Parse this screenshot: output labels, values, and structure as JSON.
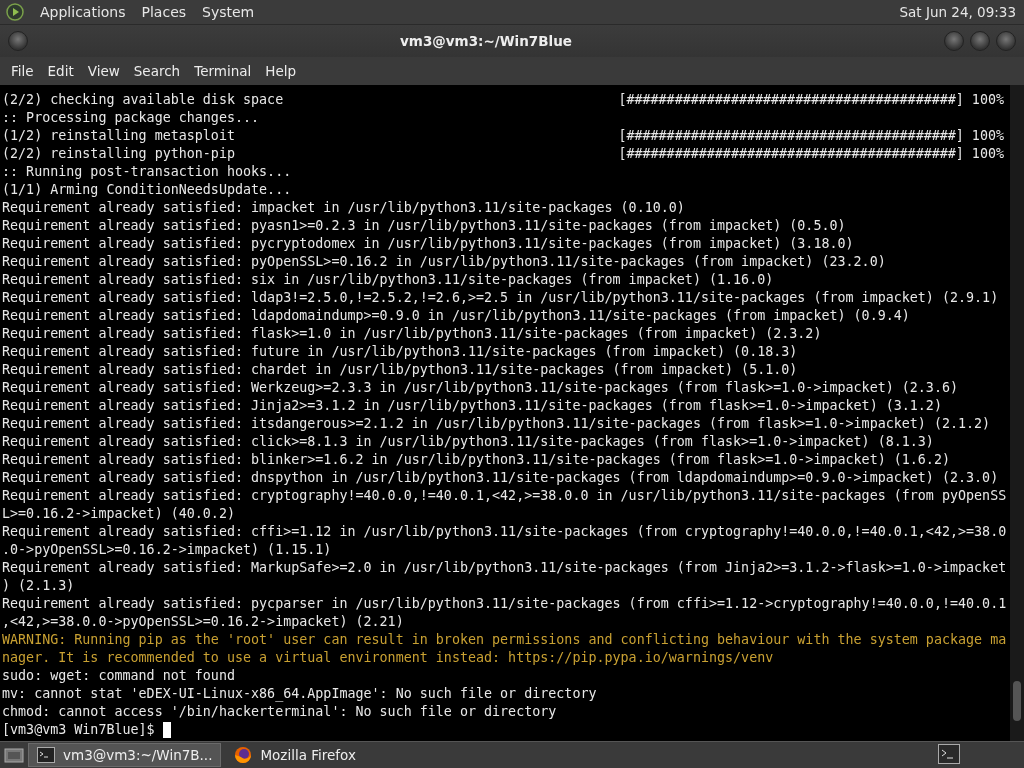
{
  "top_panel": {
    "menus": [
      "Applications",
      "Places",
      "System"
    ],
    "clock": "Sat Jun 24, 09:33"
  },
  "window": {
    "title": "vm3@vm3:~/Win7Blue"
  },
  "menu_bar": [
    "File",
    "Edit",
    "View",
    "Search",
    "Terminal",
    "Help"
  ],
  "terminal": {
    "lines": [
      {
        "kind": "progress",
        "text": "(2/2) checking available disk space",
        "bar": "[#########################################]",
        "percent": "100%"
      },
      {
        "kind": "text",
        "text": ":: Processing package changes..."
      },
      {
        "kind": "progress",
        "text": "(1/2) reinstalling metasploit",
        "bar": "[#########################################]",
        "percent": "100%"
      },
      {
        "kind": "progress",
        "text": "(2/2) reinstalling python-pip",
        "bar": "[#########################################]",
        "percent": "100%"
      },
      {
        "kind": "text",
        "text": ":: Running post-transaction hooks..."
      },
      {
        "kind": "text",
        "text": "(1/1) Arming ConditionNeedsUpdate..."
      },
      {
        "kind": "text",
        "text": "Requirement already satisfied: impacket in /usr/lib/python3.11/site-packages (0.10.0)"
      },
      {
        "kind": "text",
        "text": "Requirement already satisfied: pyasn1>=0.2.3 in /usr/lib/python3.11/site-packages (from impacket) (0.5.0)"
      },
      {
        "kind": "text",
        "text": "Requirement already satisfied: pycryptodomex in /usr/lib/python3.11/site-packages (from impacket) (3.18.0)"
      },
      {
        "kind": "text",
        "text": "Requirement already satisfied: pyOpenSSL>=0.16.2 in /usr/lib/python3.11/site-packages (from impacket) (23.2.0)"
      },
      {
        "kind": "text",
        "text": "Requirement already satisfied: six in /usr/lib/python3.11/site-packages (from impacket) (1.16.0)"
      },
      {
        "kind": "text",
        "text": "Requirement already satisfied: ldap3!=2.5.0,!=2.5.2,!=2.6,>=2.5 in /usr/lib/python3.11/site-packages (from impacket) (2.9.1)"
      },
      {
        "kind": "text",
        "text": "Requirement already satisfied: ldapdomaindump>=0.9.0 in /usr/lib/python3.11/site-packages (from impacket) (0.9.4)"
      },
      {
        "kind": "text",
        "text": "Requirement already satisfied: flask>=1.0 in /usr/lib/python3.11/site-packages (from impacket) (2.3.2)"
      },
      {
        "kind": "text",
        "text": "Requirement already satisfied: future in /usr/lib/python3.11/site-packages (from impacket) (0.18.3)"
      },
      {
        "kind": "text",
        "text": "Requirement already satisfied: chardet in /usr/lib/python3.11/site-packages (from impacket) (5.1.0)"
      },
      {
        "kind": "text",
        "text": "Requirement already satisfied: Werkzeug>=2.3.3 in /usr/lib/python3.11/site-packages (from flask>=1.0->impacket) (2.3.6)"
      },
      {
        "kind": "text",
        "text": "Requirement already satisfied: Jinja2>=3.1.2 in /usr/lib/python3.11/site-packages (from flask>=1.0->impacket) (3.1.2)"
      },
      {
        "kind": "text",
        "text": "Requirement already satisfied: itsdangerous>=2.1.2 in /usr/lib/python3.11/site-packages (from flask>=1.0->impacket) (2.1.2)"
      },
      {
        "kind": "text",
        "text": "Requirement already satisfied: click>=8.1.3 in /usr/lib/python3.11/site-packages (from flask>=1.0->impacket) (8.1.3)"
      },
      {
        "kind": "text",
        "text": "Requirement already satisfied: blinker>=1.6.2 in /usr/lib/python3.11/site-packages (from flask>=1.0->impacket) (1.6.2)"
      },
      {
        "kind": "text",
        "text": "Requirement already satisfied: dnspython in /usr/lib/python3.11/site-packages (from ldapdomaindump>=0.9.0->impacket) (2.3.0)"
      },
      {
        "kind": "text",
        "text": "Requirement already satisfied: cryptography!=40.0.0,!=40.0.1,<42,>=38.0.0 in /usr/lib/python3.11/site-packages (from pyOpenSS"
      },
      {
        "kind": "text",
        "text": "L>=0.16.2->impacket) (40.0.2)"
      },
      {
        "kind": "text",
        "text": "Requirement already satisfied: cffi>=1.12 in /usr/lib/python3.11/site-packages (from cryptography!=40.0.0,!=40.0.1,<42,>=38.0"
      },
      {
        "kind": "text",
        "text": ".0->pyOpenSSL>=0.16.2->impacket) (1.15.1)"
      },
      {
        "kind": "text",
        "text": "Requirement already satisfied: MarkupSafe>=2.0 in /usr/lib/python3.11/site-packages (from Jinja2>=3.1.2->flask>=1.0->impacket"
      },
      {
        "kind": "text",
        "text": ") (2.1.3)"
      },
      {
        "kind": "text",
        "text": "Requirement already satisfied: pycparser in /usr/lib/python3.11/site-packages (from cffi>=1.12->cryptography!=40.0.0,!=40.0.1"
      },
      {
        "kind": "text",
        "text": ",<42,>=38.0.0->pyOpenSSL>=0.16.2->impacket) (2.21)"
      },
      {
        "kind": "warning",
        "text": "WARNING: Running pip as the 'root' user can result in broken permissions and conflicting behaviour with the system package ma"
      },
      {
        "kind": "warning",
        "text": "nager. It is recommended to use a virtual environment instead: https://pip.pypa.io/warnings/venv"
      },
      {
        "kind": "text",
        "text": "sudo: wget: command not found"
      },
      {
        "kind": "text",
        "text": "mv: cannot stat 'eDEX-UI-Linux-x86_64.AppImage': No such file or directory"
      },
      {
        "kind": "text",
        "text": "chmod: cannot access '/bin/hackerterminal': No such file or directory"
      },
      {
        "kind": "prompt",
        "text": "[vm3@vm3 Win7Blue]$"
      }
    ]
  },
  "taskbar": {
    "tasks": [
      {
        "label": "vm3@vm3:~/Win7B...",
        "kind": "terminal",
        "selected": true
      },
      {
        "label": "Mozilla Firefox",
        "kind": "browser",
        "selected": false
      }
    ]
  }
}
